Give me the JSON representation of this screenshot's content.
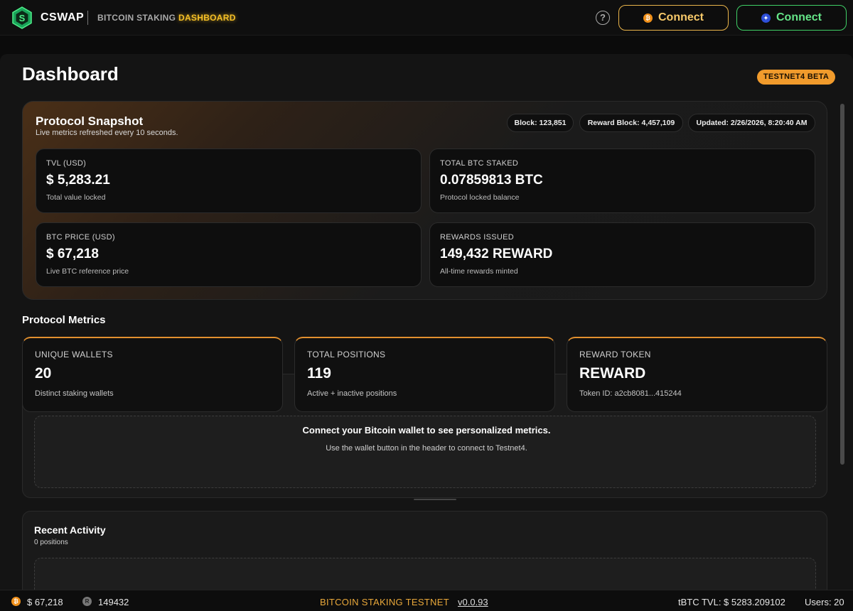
{
  "header": {
    "brand": "CSWAP",
    "nav": {
      "staking": "BITCOIN STAKING",
      "dashboard": "DASHBOARD"
    },
    "help_icon": "question-icon",
    "help_glyph": "?",
    "btc_connect": "Connect",
    "cosmos_connect": "Connect",
    "colors": {
      "btc_border": "#e9b44a",
      "cosmos_border": "#3fcf66",
      "accent": "#f6c026"
    }
  },
  "page": {
    "title": "Dashboard",
    "badge": "TESTNET4 BETA"
  },
  "snapshot": {
    "title": "Protocol Snapshot",
    "subtitle": "Live metrics refreshed every 10 seconds.",
    "chips": {
      "block": "Block: 123,851",
      "reward_block": "Reward Block: 4,457,109",
      "updated": "Updated: 2/26/2026, 8:20:40 AM"
    },
    "stats": [
      {
        "label": "TVL (USD)",
        "value": "$ 5,283.21",
        "sub": "Total value locked"
      },
      {
        "label": "TOTAL BTC STAKED",
        "value": "0.07859813 BTC",
        "sub": "Protocol locked balance"
      },
      {
        "label": "BTC PRICE (USD)",
        "value": "$ 67,218",
        "sub": "Live BTC reference price"
      },
      {
        "label": "REWARDS ISSUED",
        "value": "149,432 REWARD",
        "sub": "All-time rewards minted"
      }
    ]
  },
  "metrics": {
    "title": "Protocol Metrics",
    "cards": [
      {
        "label": "UNIQUE WALLETS",
        "value": "20",
        "sub": "Distinct staking wallets"
      },
      {
        "label": "TOTAL POSITIONS",
        "value": "119",
        "sub": "Active + inactive positions"
      },
      {
        "label": "REWARD TOKEN",
        "value": "REWARD",
        "sub": "Token ID: a2cb8081...415244"
      }
    ],
    "connect_prompt": "Connect your Bitcoin wallet to see personalized metrics.",
    "connect_hint": "Use the wallet button in the header to connect to Testnet4."
  },
  "recent": {
    "title": "Recent Activity",
    "count": "0 positions"
  },
  "footer": {
    "btc_price": "$ 67,218",
    "reward_count": "149432",
    "btc_glyph": "₿",
    "reward_glyph": "R",
    "center": "BITCOIN STAKING TESTNET",
    "version": "v0.0.93",
    "tvl": "tBTC TVL: $ 5283.209102",
    "users": "Users: 20"
  }
}
